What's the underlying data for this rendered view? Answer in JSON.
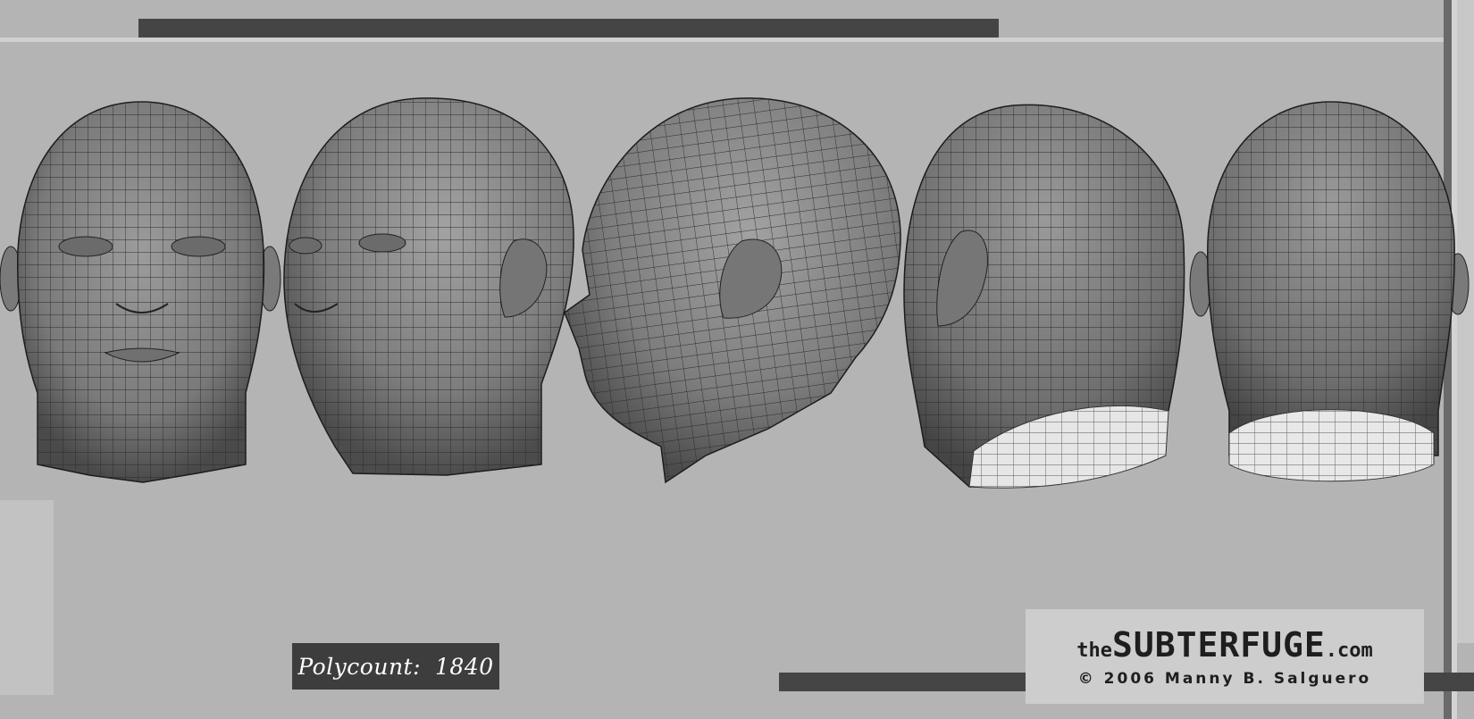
{
  "polycount": {
    "label": "Polycount:",
    "value": "1840"
  },
  "logo": {
    "prefix": "the",
    "name": "SUBTERFUGE",
    "suffix": ".com",
    "copyright": "© 2006 Manny B. Salguero"
  },
  "colors": {
    "background": "#b4b4b4",
    "bar": "#454545",
    "head_fill": "#8a8a8a",
    "wire": "#262626"
  }
}
